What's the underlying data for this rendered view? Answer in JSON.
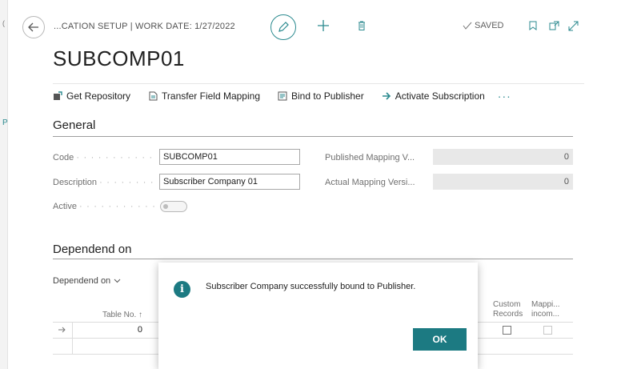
{
  "header": {
    "breadcrumb": "...CATION SETUP | WORK DATE: 1/27/2022",
    "status": "SAVED"
  },
  "page": {
    "title": "SUBCOMP01"
  },
  "actions": [
    {
      "label": "Get Repository",
      "icon": "repository-icon"
    },
    {
      "label": "Transfer Field Mapping",
      "icon": "document-icon"
    },
    {
      "label": "Bind to Publisher",
      "icon": "bind-icon"
    },
    {
      "label": "Activate Subscription",
      "icon": "arrow-right-icon"
    }
  ],
  "general": {
    "section_title": "General",
    "code_label": "Code",
    "code_value": "SUBCOMP01",
    "description_label": "Description",
    "description_value": "Subscriber Company 01",
    "active_label": "Active",
    "active_value": false,
    "published_mapping_label": "Published Mapping V...",
    "published_mapping_value": "0",
    "actual_mapping_label": "Actual Mapping Versi...",
    "actual_mapping_value": "0"
  },
  "dependend": {
    "section_title": "Dependend on",
    "menu_label": "Dependend on",
    "columns": {
      "table_no": "Table No. ↑",
      "custom_records_1": "Custom",
      "custom_records_2": "Records",
      "mapping_1": "Mappi...",
      "mapping_2": "incom..."
    },
    "rows": [
      {
        "table_no": "0"
      }
    ]
  },
  "dialog": {
    "message": "Subscriber Company successfully bound to Publisher.",
    "ok_label": "OK"
  },
  "colors": {
    "accent": "#1c7a82",
    "teal_icon": "#2b8a8f"
  }
}
